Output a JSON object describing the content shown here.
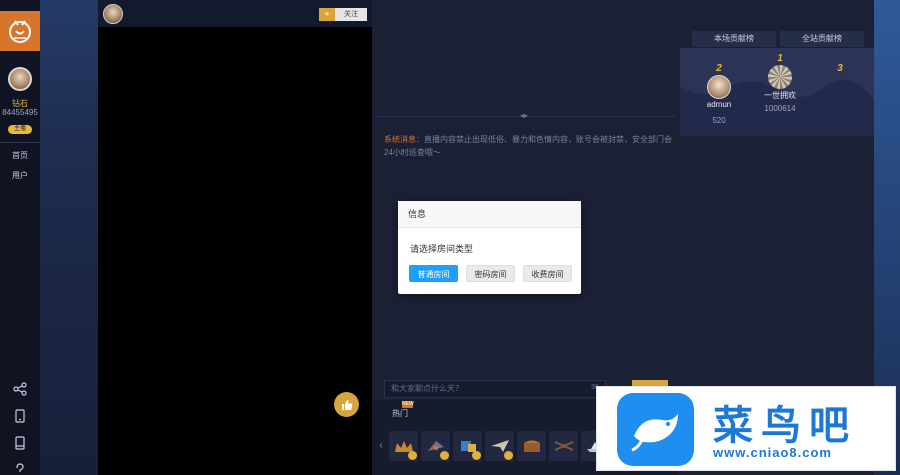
{
  "sidebar": {
    "user_name": "钻石",
    "user_coins": "84455495",
    "badge": "主播",
    "nav": [
      {
        "label": "首页"
      },
      {
        "label": "用户"
      }
    ]
  },
  "player": {
    "follow_plus": "+",
    "follow_label": "关注"
  },
  "ranking": {
    "tabs": [
      {
        "label": "本场贡献榜"
      },
      {
        "label": "全站贡献榜"
      }
    ],
    "entries": [
      {
        "rank": "2",
        "name": "admun",
        "score": "520"
      },
      {
        "rank": "1",
        "name": "一世拥欢",
        "score": "1000614"
      },
      {
        "rank": "3",
        "name": "",
        "score": ""
      }
    ]
  },
  "chat": {
    "system_tag": "系统消息：",
    "system_text": "直播内容禁止出现低俗、暴力和色情内容，账号会被封禁，安全部门会24小时巡查哦～",
    "input_placeholder": "和大家聊点什么天？",
    "char_count": "30"
  },
  "modal": {
    "title": "信息",
    "message": "请选择房间类型",
    "buttons": [
      {
        "label": "普通房间",
        "primary": true
      },
      {
        "label": "密码房间",
        "primary": false
      },
      {
        "label": "收费房间",
        "primary": false
      }
    ]
  },
  "gifts": {
    "tab": "热门",
    "tab_badge": "NEW",
    "items": [
      {
        "name": "tiara-icon",
        "color": "#c98a2d"
      },
      {
        "name": "fan-icon",
        "color": "#7a6b86"
      },
      {
        "name": "cube-icon",
        "color": "#3b7bd4"
      },
      {
        "name": "paper-plane-icon",
        "color": "#d0c4b0"
      },
      {
        "name": "chest-icon",
        "color": "#9a5a2a"
      },
      {
        "name": "dragonfly-icon",
        "color": "#7a5a3a"
      },
      {
        "name": "ship-icon",
        "color": "#b8c6d8"
      }
    ]
  },
  "watermark": {
    "brand": "菜鸟吧",
    "url": "www.cniao8.com"
  },
  "colors": {
    "accent": "#d7752b",
    "gold": "#e9b93a",
    "primary_button": "#1e9fff",
    "background": "#1c2034"
  }
}
